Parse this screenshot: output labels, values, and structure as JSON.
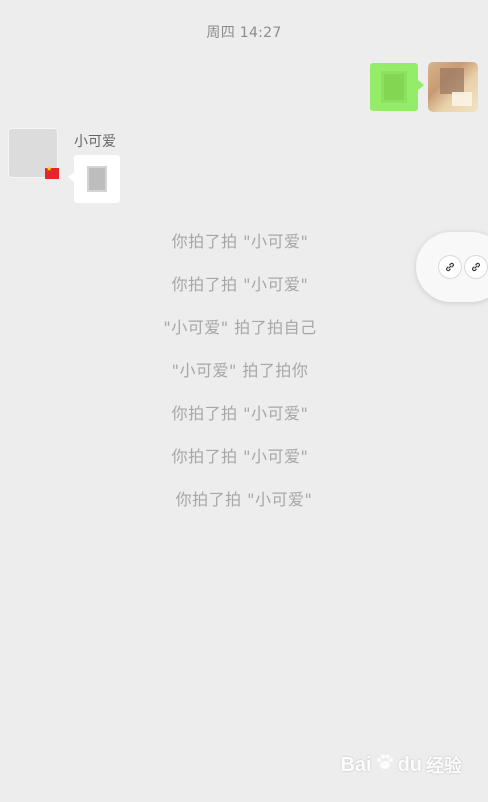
{
  "chat": {
    "timestamp": "周四 14:27",
    "outgoing": {
      "bubble_icon": "green-sticker-icon",
      "bubble_color": "#95ec69",
      "avatar": "blurred-user-avatar"
    },
    "incoming": {
      "sender_name": "小可爱",
      "avatar_badge": "china-flag-icon",
      "bubble_color": "#ffffff"
    },
    "pat_messages": [
      "你拍了拍 \"小可爱\"",
      "你拍了拍 \"小可爱\"",
      "\"小可爱\" 拍了拍自己",
      "\"小可爱\" 拍了拍你",
      "你拍了拍 \"小可爱\"",
      "你拍了拍 \"小可爱\"",
      "你拍了拍 \"小可爱\""
    ]
  },
  "floating_widget": {
    "icons": [
      "link-icon",
      "link-icon"
    ]
  },
  "watermark": {
    "text_left": "Bai",
    "text_right": "du",
    "text_cn": "经验"
  },
  "colors": {
    "background": "#ededed",
    "pat_text": "#a7a7a7",
    "timestamp_text": "#8c8c8c",
    "outgoing_bubble": "#95ec69"
  }
}
